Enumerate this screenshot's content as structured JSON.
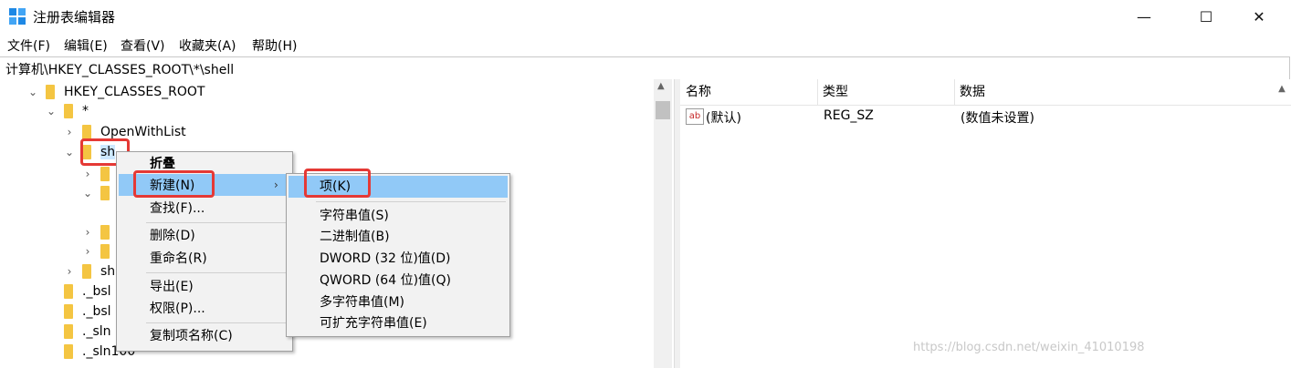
{
  "window": {
    "title": "注册表编辑器",
    "controls": [
      "—",
      "☐",
      "✕"
    ]
  },
  "menubar": [
    "文件(F)",
    "编辑(E)",
    "查看(V)",
    "收藏夹(A)",
    "帮助(H)"
  ],
  "address": "计算机\\HKEY_CLASSES_ROOT\\*\\shell",
  "tree": {
    "root": "HKEY_CLASSES_ROOT",
    "star": "*",
    "openwithlist": "OpenWithList",
    "shell": "sh",
    "shell_partial": "sh",
    "items": [
      "._bsl",
      "._bsl",
      "._sln",
      "._sln100"
    ]
  },
  "list": {
    "columns": [
      "名称",
      "类型",
      "数据"
    ],
    "rows": [
      {
        "icon": "ab",
        "name": "(默认)",
        "type": "REG_SZ",
        "data": "(数值未设置)"
      }
    ]
  },
  "context_menu": {
    "items": [
      "折叠",
      "新建(N)",
      "查找(F)...",
      "删除(D)",
      "重命名(R)",
      "导出(E)",
      "权限(P)...",
      "复制项名称(C)"
    ]
  },
  "submenu": {
    "items": [
      "项(K)",
      "字符串值(S)",
      "二进制值(B)",
      "DWORD (32 位)值(D)",
      "QWORD (64 位)值(Q)",
      "多字符串值(M)",
      "可扩充字符串值(E)"
    ]
  },
  "watermark": "https://blog.csdn.net/weixin_41010198",
  "colors": {
    "highlight": "#91c9f7",
    "annotation_red": "#e53935",
    "folder": "#f4c542"
  }
}
